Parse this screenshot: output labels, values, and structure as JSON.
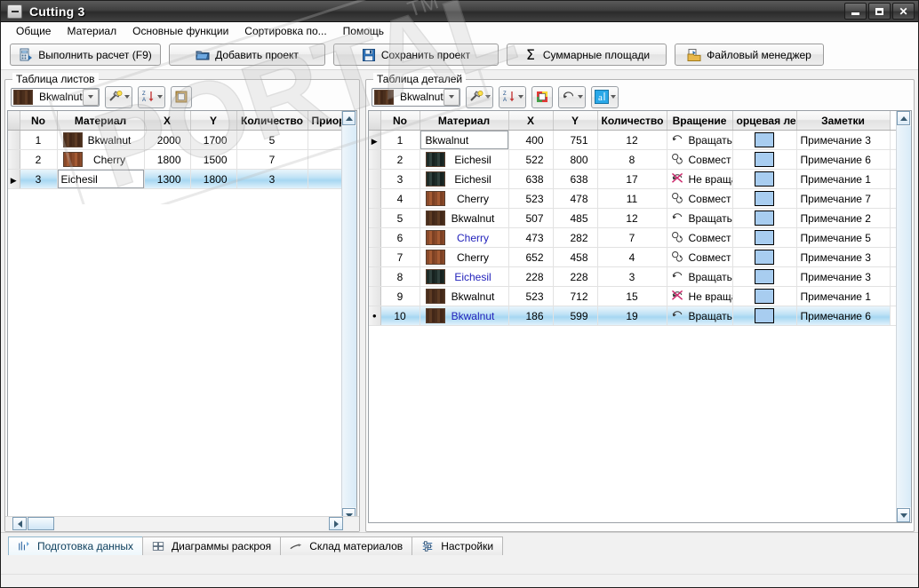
{
  "window": {
    "title": "Cutting 3",
    "system_icon": "minimize-box-icon",
    "buttons": {
      "minimize": "minimize-icon",
      "maximize": "maximize-icon",
      "close": "close-icon"
    }
  },
  "menubar": {
    "items": [
      {
        "label": "Общие"
      },
      {
        "label": "Материал"
      },
      {
        "label": "Основные функции"
      },
      {
        "label": "Сортировка по..."
      },
      {
        "label": "Помощь"
      }
    ]
  },
  "toolbar": {
    "buttons": [
      {
        "label": "Выполнить расчет  (F9)",
        "icon": "calculate-icon"
      },
      {
        "label": "Добавить проект",
        "icon": "folder-add-icon"
      },
      {
        "label": "Сохранить проект",
        "icon": "save-disk-icon"
      },
      {
        "label": "Суммарные площади",
        "icon": "sigma-icon"
      },
      {
        "label": "Файловый менеджер",
        "icon": "file-manager-icon"
      }
    ]
  },
  "sheets_panel": {
    "legend": "Таблица листов",
    "material_combo": {
      "value": "Bkwalnut",
      "swatch": "bkwalnut"
    },
    "tool_buttons": [
      {
        "icon": "hammer-tools-icon",
        "split": true
      },
      {
        "icon": "sort-za-icon",
        "split": true
      },
      {
        "icon": "square-frame-icon",
        "split": false
      }
    ],
    "columns": [
      "No",
      "Материал",
      "X",
      "Y",
      "Количество",
      "Приоритет"
    ],
    "rows": [
      {
        "mark": "",
        "no": "1",
        "material": "Bkwalnut",
        "swatch": "bkwalnut",
        "x": "2000",
        "y": "1700",
        "qty": "5",
        "priority": "",
        "selected": false,
        "editing": false
      },
      {
        "mark": "",
        "no": "2",
        "material": "Cherry",
        "swatch": "cherry",
        "x": "1800",
        "y": "1500",
        "qty": "7",
        "priority": "",
        "selected": false,
        "editing": false
      },
      {
        "mark": "▶",
        "no": "3",
        "material": "Eichesil",
        "swatch": "",
        "x": "1300",
        "y": "1800",
        "qty": "3",
        "priority": "",
        "selected": true,
        "editing": true
      }
    ]
  },
  "parts_panel": {
    "legend": "Таблица деталей",
    "material_combo": {
      "value": "Bkwalnut",
      "swatch": "bkwalnut"
    },
    "tool_buttons": [
      {
        "icon": "hammer-tools-icon",
        "split": true
      },
      {
        "icon": "sort-za-icon",
        "split": true
      },
      {
        "icon": "color-frame-icon",
        "split": false
      },
      {
        "icon": "rotate-icon",
        "split": true
      },
      {
        "icon": "edge-band-icon",
        "split": true
      }
    ],
    "columns": [
      "No",
      "Материал",
      "X",
      "Y",
      "Количество",
      "Вращение",
      "орцевая лен",
      "Заметки"
    ],
    "rows": [
      {
        "mark": "▶",
        "no": "1",
        "material": "Bkwalnut",
        "swatch": "",
        "x": "400",
        "y": "751",
        "qty": "12",
        "rotation": "Вращать",
        "rot_icon": "rotate-allow-icon",
        "edge": "edge-swatch",
        "note": "Примечание 3",
        "selected": false,
        "editing": true,
        "blue_name": false
      },
      {
        "mark": "",
        "no": "2",
        "material": "Eichesil",
        "swatch": "eichesil",
        "x": "522",
        "y": "800",
        "qty": "8",
        "rotation": "Совмест",
        "rot_icon": "rotate-combine-icon",
        "edge": "edge-swatch",
        "note": "Примечание 6",
        "selected": false,
        "editing": false,
        "blue_name": false
      },
      {
        "mark": "",
        "no": "3",
        "material": "Eichesil",
        "swatch": "eichesil",
        "x": "638",
        "y": "638",
        "qty": "17",
        "rotation": "Не враща",
        "rot_icon": "rotate-deny-icon",
        "edge": "edge-swatch",
        "note": "Примечание 1",
        "selected": false,
        "editing": false,
        "blue_name": false
      },
      {
        "mark": "",
        "no": "4",
        "material": "Cherry",
        "swatch": "cherry",
        "x": "523",
        "y": "478",
        "qty": "11",
        "rotation": "Совмест",
        "rot_icon": "rotate-combine-icon",
        "edge": "edge-swatch",
        "note": "Примечание 7",
        "selected": false,
        "editing": false,
        "blue_name": false
      },
      {
        "mark": "",
        "no": "5",
        "material": "Bkwalnut",
        "swatch": "bkwalnut",
        "x": "507",
        "y": "485",
        "qty": "12",
        "rotation": "Вращать",
        "rot_icon": "rotate-allow-icon",
        "edge": "edge-swatch",
        "note": "Примечание 2",
        "selected": false,
        "editing": false,
        "blue_name": false
      },
      {
        "mark": "",
        "no": "6",
        "material": "Cherry",
        "swatch": "cherry",
        "x": "473",
        "y": "282",
        "qty": "7",
        "rotation": "Совмест",
        "rot_icon": "rotate-combine-icon",
        "edge": "edge-swatch",
        "note": "Примечание 5",
        "selected": false,
        "editing": false,
        "blue_name": true
      },
      {
        "mark": "",
        "no": "7",
        "material": "Cherry",
        "swatch": "cherry",
        "x": "652",
        "y": "458",
        "qty": "4",
        "rotation": "Совмест",
        "rot_icon": "rotate-combine-icon",
        "edge": "edge-swatch",
        "note": "Примечание 3",
        "selected": false,
        "editing": false,
        "blue_name": false
      },
      {
        "mark": "",
        "no": "8",
        "material": "Eichesil",
        "swatch": "eichesil",
        "x": "228",
        "y": "228",
        "qty": "3",
        "rotation": "Вращать",
        "rot_icon": "rotate-allow-icon",
        "edge": "edge-swatch",
        "note": "Примечание 3",
        "selected": false,
        "editing": false,
        "blue_name": true
      },
      {
        "mark": "",
        "no": "9",
        "material": "Bkwalnut",
        "swatch": "bkwalnut",
        "x": "523",
        "y": "712",
        "qty": "15",
        "rotation": "Не враща",
        "rot_icon": "rotate-deny-icon",
        "edge": "edge-swatch",
        "note": "Примечание 1",
        "selected": false,
        "editing": false,
        "blue_name": false
      },
      {
        "mark": "•",
        "no": "10",
        "material": "Bkwalnut",
        "swatch": "bkwalnut",
        "x": "186",
        "y": "599",
        "qty": "19",
        "rotation": "Вращать",
        "rot_icon": "rotate-allow-icon",
        "edge": "edge-swatch",
        "note": "Примечание 6",
        "selected": true,
        "editing": false,
        "blue_name": true
      }
    ]
  },
  "tabs": [
    {
      "label": "Подготовка данных",
      "icon": "data-prep-icon",
      "active": true
    },
    {
      "label": "Диаграммы раскроя",
      "icon": "layout-grid-icon",
      "active": false
    },
    {
      "label": "Склад материалов",
      "icon": "warehouse-icon",
      "active": false
    },
    {
      "label": "Настройки",
      "icon": "settings-icon",
      "active": false
    }
  ],
  "watermark": {
    "text": "PORTAL",
    "suffix": "TM"
  },
  "colors": {
    "selection": "#a6d7f2",
    "edge_band": "#a8cdf0",
    "title_bar": "#3f3f3f",
    "panel_bg": "#fdfdfd",
    "link_text": "#2222bb"
  }
}
